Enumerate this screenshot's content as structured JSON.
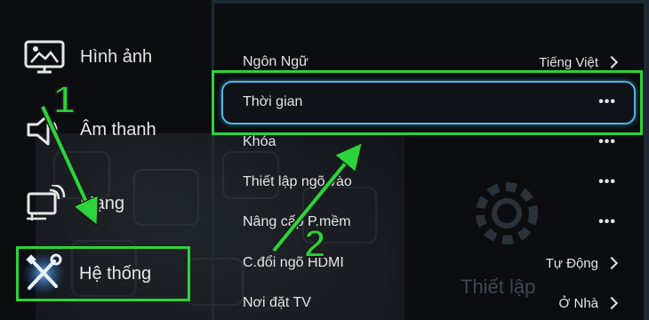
{
  "sidebar": {
    "items": [
      {
        "label": "Hình ảnh"
      },
      {
        "label": "Âm thanh"
      },
      {
        "label": "Mạng"
      },
      {
        "label": "Hệ thống"
      }
    ]
  },
  "settings": {
    "rows": [
      {
        "label": "Ngôn Ngữ",
        "value": "Tiếng Việt"
      },
      {
        "label": "Thời gian",
        "value": "•••"
      },
      {
        "label": "Khóa",
        "value": "•••"
      },
      {
        "label": "Thiết lập ngõ vào",
        "value": "•••"
      },
      {
        "label": "Nâng cấp P.mềm",
        "value": "•••"
      },
      {
        "label": "C.đổi ngõ HDMI",
        "value": "Tự Động"
      },
      {
        "label": "Nơi đặt TV",
        "value": "Ở Nhà"
      }
    ]
  },
  "background_panel": {
    "label": "Thiết lập"
  },
  "annotations": {
    "step1": "1",
    "step2": "2",
    "color": "#2bd43a"
  }
}
